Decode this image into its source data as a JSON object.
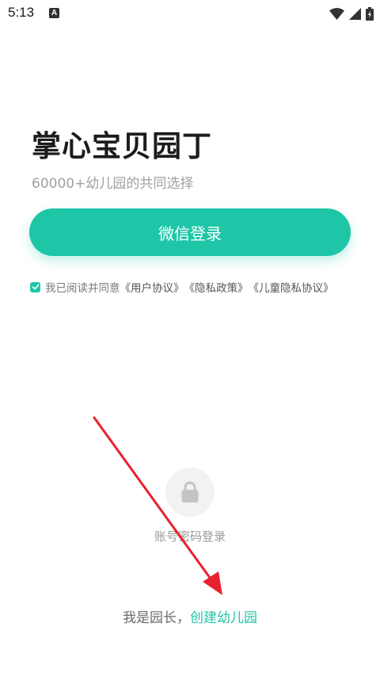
{
  "status_bar": {
    "time": "5:13",
    "notification_icon": "a-text-icon",
    "a_glyph": "A",
    "icons": [
      "wifi-icon",
      "cell-signal-icon",
      "battery-icon"
    ]
  },
  "header": {
    "title": "掌心宝贝园丁",
    "subtitle": "60000+幼儿园的共同选择"
  },
  "wechat_login": {
    "label": "微信登录"
  },
  "agreement": {
    "checked": true,
    "prefix": "我已阅读并同意",
    "links": [
      "《用户协议》",
      "《隐私政策》",
      "《儿童隐私协议》"
    ]
  },
  "password_login": {
    "icon": "lock-icon",
    "label": "账号密码登录"
  },
  "create_kindergarten": {
    "prompt": "我是园长，",
    "link": "创建幼儿园"
  },
  "colors": {
    "accent": "#1ec6a7",
    "annotation_arrow": "#e8212e"
  }
}
